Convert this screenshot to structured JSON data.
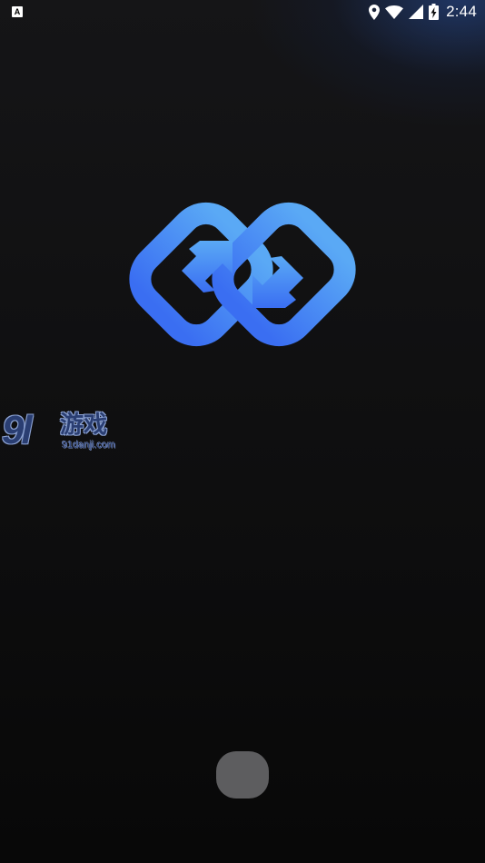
{
  "status_bar": {
    "notification_icon": "font-a-icon",
    "icons": [
      "location-icon",
      "wifi-icon",
      "signal-icon",
      "battery-charging-icon"
    ],
    "time": "2:44"
  },
  "logo": {
    "icon": "linked-rings-sync-arrows-icon",
    "gradient_top": "#5aa9f5",
    "gradient_bottom": "#3a6ef2"
  },
  "watermark": {
    "digits": "9l",
    "chinese": "游戏",
    "url": "91danji.com"
  },
  "home_button": {
    "icon": "home-pill-icon"
  }
}
